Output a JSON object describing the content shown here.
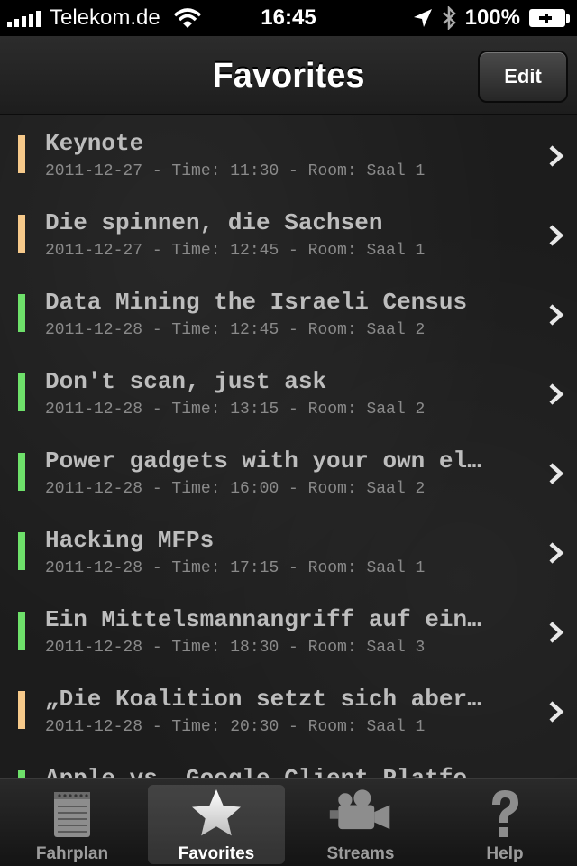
{
  "status_bar": {
    "carrier": "Telekom.de",
    "time": "16:45",
    "battery": "100%"
  },
  "nav": {
    "title": "Favorites",
    "edit_label": "Edit"
  },
  "colors": {
    "orange": "#f6c98a",
    "green": "#6ee06a"
  },
  "favorites": [
    {
      "title": "Keynote",
      "meta": "2011-12-27 - Time: 11:30 - Room: Saal 1",
      "color": "orange"
    },
    {
      "title": "Die spinnen, die Sachsen",
      "meta": "2011-12-27 - Time: 12:45 - Room: Saal 1",
      "color": "orange"
    },
    {
      "title": "Data Mining the Israeli Census",
      "meta": "2011-12-28 - Time: 12:45 - Room: Saal 2",
      "color": "green"
    },
    {
      "title": "Don't scan, just ask",
      "meta": "2011-12-28 - Time: 13:15 - Room: Saal 2",
      "color": "green"
    },
    {
      "title": "Power gadgets with your own el…",
      "meta": "2011-12-28 - Time: 16:00 - Room: Saal 2",
      "color": "green"
    },
    {
      "title": "Hacking MFPs",
      "meta": "2011-12-28 - Time: 17:15 - Room: Saal 1",
      "color": "green"
    },
    {
      "title": "Ein Mittelsmannangriff auf ein…",
      "meta": "2011-12-28 - Time: 18:30 - Room: Saal 3",
      "color": "green"
    },
    {
      "title": "„Die Koalition setzt sich aber…",
      "meta": "2011-12-28 - Time: 20:30 - Room: Saal 1",
      "color": "orange"
    },
    {
      "title": "Apple vs. Google Client Platfo…",
      "meta": "",
      "color": "green"
    }
  ],
  "tabs": [
    {
      "label": "Fahrplan",
      "icon": "notepad-icon",
      "active": false
    },
    {
      "label": "Favorites",
      "icon": "star-icon",
      "active": true
    },
    {
      "label": "Streams",
      "icon": "video-camera-icon",
      "active": false
    },
    {
      "label": "Help",
      "icon": "question-mark-icon",
      "active": false
    }
  ]
}
